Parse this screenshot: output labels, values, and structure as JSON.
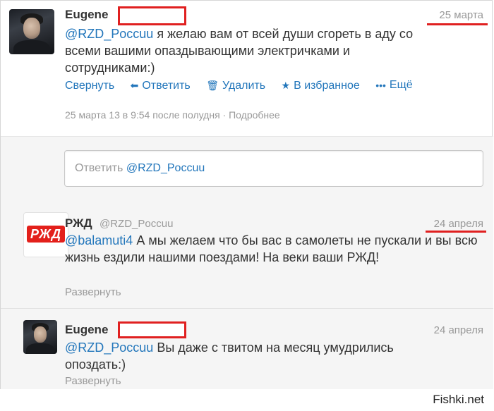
{
  "tweet1": {
    "name": "Eugene",
    "date": "25 марта",
    "mention": "@RZD_Poccuu",
    "text": " я желаю вам от всей души сгореть в аду со всеми вашими опаздывающими электричками и сотрудниками:)",
    "actions": {
      "collapse": "Свернуть",
      "reply": "Ответить",
      "delete": "Удалить",
      "favorite": "В избранное",
      "more": "Ещё"
    },
    "meta": "25 марта 13 в 9:54 после полудня · Подробнее"
  },
  "reply_box": {
    "prefix": "Ответить ",
    "mention": "@RZD_Poccuu"
  },
  "tweet2": {
    "name": "РЖД",
    "screen_name": "@RZD_Poccuu",
    "date": "24 апреля",
    "mention": "@balamuti4",
    "text": " А мы желаем что бы вас в самолеты не пускали и вы всю жизнь ездили нашими поездами! На веки ваши РЖД!",
    "expand": "Развернуть",
    "logo_text": "РЖД"
  },
  "tweet3": {
    "name": "Eugene",
    "date": "24 апреля",
    "mention": "@RZD_Poccuu",
    "text": " Вы даже с твитом на месяц умудрились опоздать:)",
    "expand": "Развернуть"
  },
  "watermark": "Fishki.net",
  "colors": {
    "link": "#2276bb",
    "redaction": "#e02020",
    "muted": "#999999",
    "rzd_red": "#e3201b"
  }
}
